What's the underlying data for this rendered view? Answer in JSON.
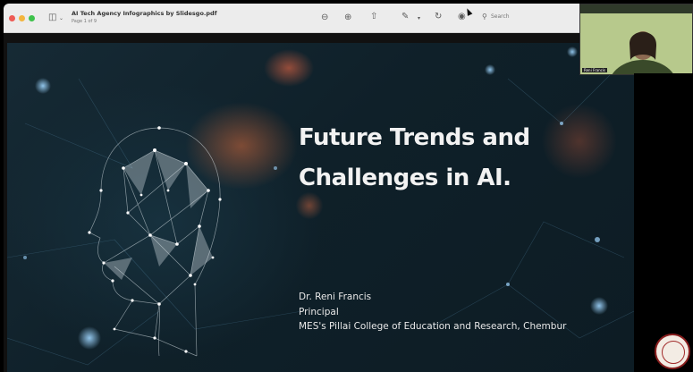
{
  "window": {
    "title": "AI Tech Agency Infographics by Slidesgo.pdf",
    "page_indicator": "Page 1 of 9"
  },
  "toolbar": {
    "search_placeholder": "Search",
    "icons": [
      "sidebar-icon",
      "zoom-out-icon",
      "zoom-in-icon",
      "share-icon",
      "markup-icon",
      "rotate-icon",
      "annotate-icon",
      "search-icon"
    ]
  },
  "slide": {
    "title_line1": "Future Trends and",
    "title_line2": "Challenges in AI.",
    "presenter_name": "Dr. Reni Francis",
    "presenter_role": "Principal",
    "presenter_org": "MES's Pillai College of Education and Research, Chembur"
  },
  "video_tile": {
    "participant": "Reni Francis"
  },
  "colors": {
    "slide_bg": "#0f2029",
    "accent_orange": "#ff7840",
    "title_text": "#f2f2f2"
  }
}
